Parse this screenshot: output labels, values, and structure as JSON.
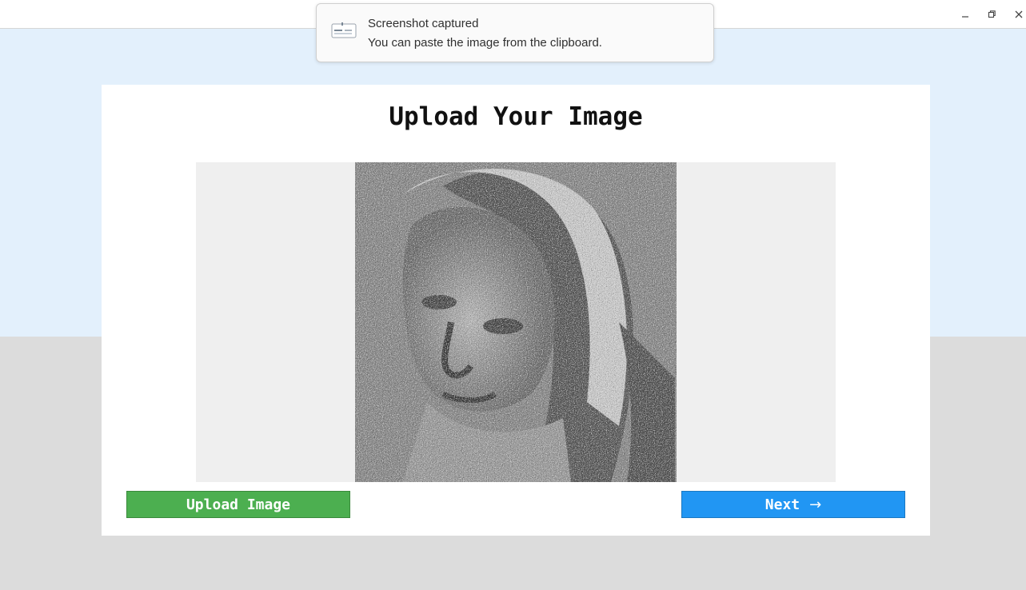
{
  "window": {
    "controls": {
      "minimize_icon": "minimize-icon",
      "maximize_icon": "maximize-icon",
      "close_icon": "close-icon"
    }
  },
  "notification": {
    "title": "Screenshot captured",
    "body": "You can paste the image from the clipboard.",
    "icon": "screenshot-icon"
  },
  "main": {
    "title": "Upload Your Image",
    "preview": {
      "description_icon": "uploaded-image"
    },
    "buttons": {
      "upload_label": "Upload Image",
      "next_label": "Next",
      "next_icon": "arrow-right-icon"
    }
  },
  "colors": {
    "upload_button": "#4caf50",
    "next_button": "#2196f3",
    "background_top": "#e3f0fc",
    "background_bottom": "#dcdcdc"
  }
}
